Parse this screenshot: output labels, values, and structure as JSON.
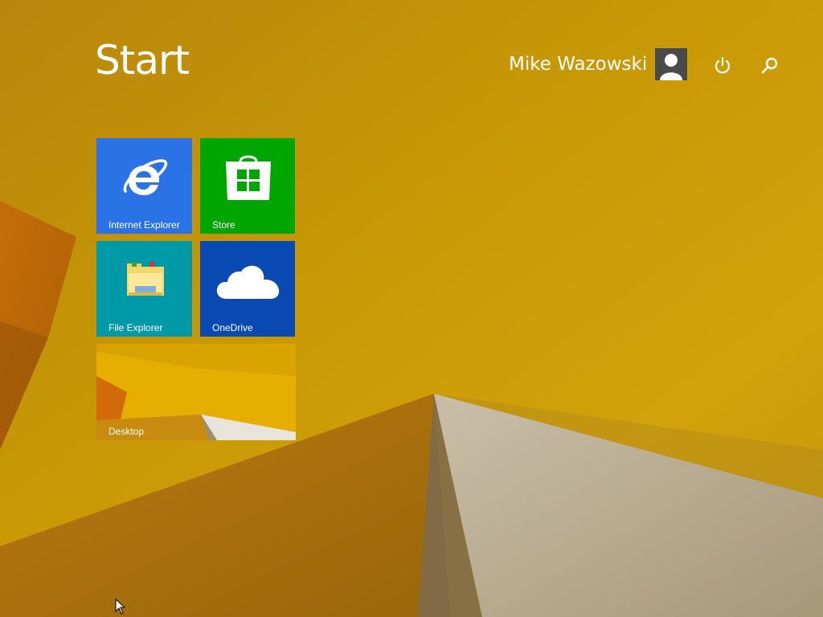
{
  "header": {
    "title": "Start",
    "user_name": "Mike Wazowski"
  },
  "icons": {
    "avatar": "user-avatar-icon",
    "power": "power-icon",
    "search": "search-icon"
  },
  "tiles": [
    {
      "label": "Internet Explorer",
      "icon": "internet-explorer-icon",
      "color": "#2a73e6"
    },
    {
      "label": "Store",
      "icon": "store-icon",
      "color": "#00a600"
    },
    {
      "label": "File Explorer",
      "icon": "file-explorer-icon",
      "color": "#0099a8"
    },
    {
      "label": "OneDrive",
      "icon": "onedrive-icon",
      "color": "#094ab2"
    },
    {
      "label": "Desktop",
      "icon": "desktop-wallpaper-thumbnail",
      "color": "#e0a800"
    }
  ],
  "colors": {
    "background": "#b98a00",
    "text": "#ffffff"
  }
}
